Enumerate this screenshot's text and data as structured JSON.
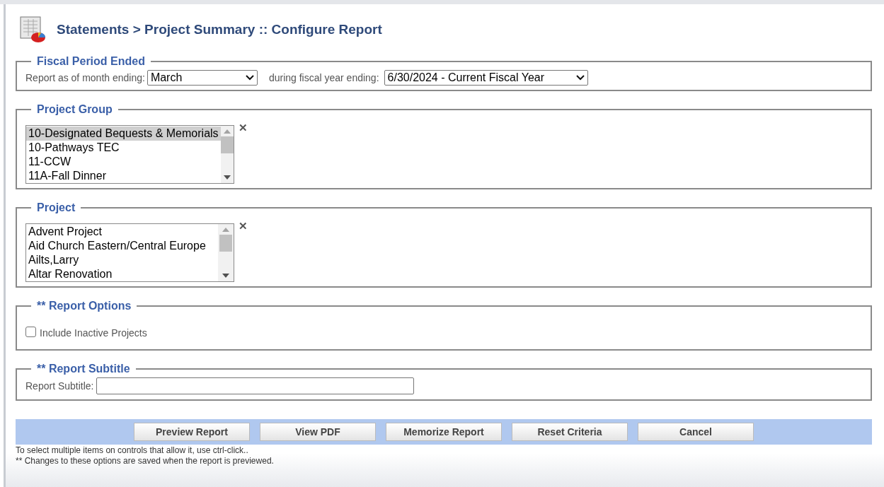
{
  "title": "Statements > Project Summary :: Configure Report",
  "sections": [
    {
      "kind": "period",
      "legend": "Fiscal Period Ended",
      "month_label": "Report as of month ending:",
      "month_value": "March",
      "year_label": "during fiscal year ending:",
      "year_value": "6/30/2024 - Current Fiscal Year"
    },
    {
      "kind": "list",
      "legend": "Project Group",
      "clear": "✕",
      "items": [
        {
          "label": "10-Designated Bequests & Memorials",
          "selected": true
        },
        {
          "label": "10-Pathways TEC",
          "selected": false
        },
        {
          "label": "11-CCW",
          "selected": false
        },
        {
          "label": "11A-Fall Dinner",
          "selected": false
        }
      ]
    },
    {
      "kind": "list",
      "legend": "Project",
      "clear": "✕",
      "items": [
        {
          "label": "Advent Project",
          "selected": false
        },
        {
          "label": "Aid Church Eastern/Central Europe",
          "selected": false
        },
        {
          "label": "Ailts,Larry",
          "selected": false
        },
        {
          "label": "Altar Renovation",
          "selected": false
        }
      ]
    },
    {
      "kind": "options",
      "legend": "** Report Options",
      "checkbox": {
        "label": "Include Inactive Projects",
        "checked": false
      }
    },
    {
      "kind": "subtitle",
      "legend": "** Report Subtitle",
      "label": "Report Subtitle:"
    }
  ],
  "buttons": [
    "Preview Report",
    "View PDF",
    "Memorize Report",
    "Reset Criteria",
    "Cancel"
  ],
  "notes": [
    "To select multiple items on controls that allow it, use ctrl-click..",
    "** Changes to these options are saved when the report is previewed."
  ]
}
